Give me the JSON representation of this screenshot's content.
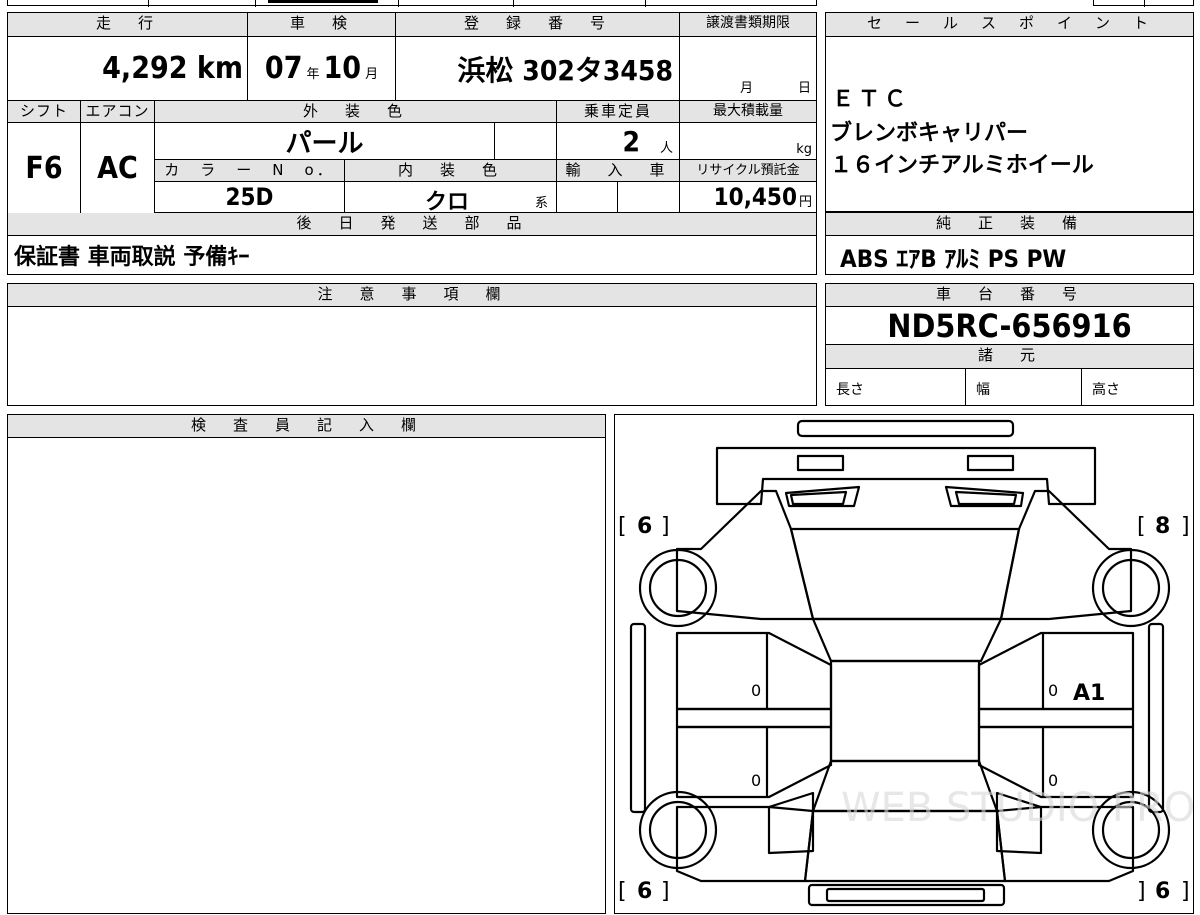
{
  "top_info": {
    "headers": {
      "mileage": "走　行",
      "inspection": "車　検",
      "registration": "登　録　番　号",
      "transfer_deadline": "譲渡書類期限",
      "shift": "シフト",
      "aircon": "エアコン",
      "exterior_color": "外　装　色",
      "capacity": "乗車定員",
      "max_load": "最大積載量",
      "color_no": "カ　ラ　ー　N　o．",
      "interior_color": "内　装　色",
      "import": "輸　入　車",
      "recycle": "リサイクル預託金",
      "later_parts": "後　日　発　送　部　品"
    },
    "mileage_value": "4,292",
    "mileage_unit": "km",
    "inspection_year": "07",
    "inspection_year_unit": "年",
    "inspection_month": "10",
    "inspection_month_unit": "月",
    "registration_value": "浜松 302タ3458",
    "transfer_month_unit": "月",
    "transfer_day_unit": "日",
    "shift_value": "F6",
    "aircon_value": "AC",
    "exterior_color_value": "パール",
    "capacity_value": "2",
    "capacity_unit": "人",
    "max_load_unit": "kg",
    "color_no_value": "25D",
    "interior_color_value": "クロ",
    "interior_color_unit": "系",
    "recycle_value": "10,450",
    "recycle_unit": "円",
    "later_parts_value": "保証書 車両取説 予備ｷｰ"
  },
  "sales_points": {
    "header": "セ　ー　ル　ス　ポ　イ　ン　ト",
    "lines": [
      "ＥＴＣ",
      "ブレンボキャリパー",
      "１６インチアルミホイール"
    ]
  },
  "standard_equipment": {
    "header": "純　正　装　備",
    "value": "ABS ｴｱB ｱﾙﾐ PS PW"
  },
  "notes": {
    "header": "注　意　事　項　欄"
  },
  "chassis": {
    "header": "車　台　番　号",
    "value": "ND5RC-656916"
  },
  "specs": {
    "header": "諸　元",
    "length": "長さ",
    "width": "幅",
    "height": "高さ"
  },
  "inspector": {
    "header": "検　査　員　記　入　欄"
  },
  "diagram": {
    "tire_front_left": "6",
    "tire_front_right": "8",
    "tire_rear_left": "6",
    "tire_rear_right": "6",
    "door_front_left_mark": "0",
    "door_rear_left_mark": "0",
    "door_front_right_mark": "0",
    "door_rear_right_mark": "0",
    "damage_front_right_door": "A1",
    "watermark": "WEB STUDIO PRO"
  }
}
